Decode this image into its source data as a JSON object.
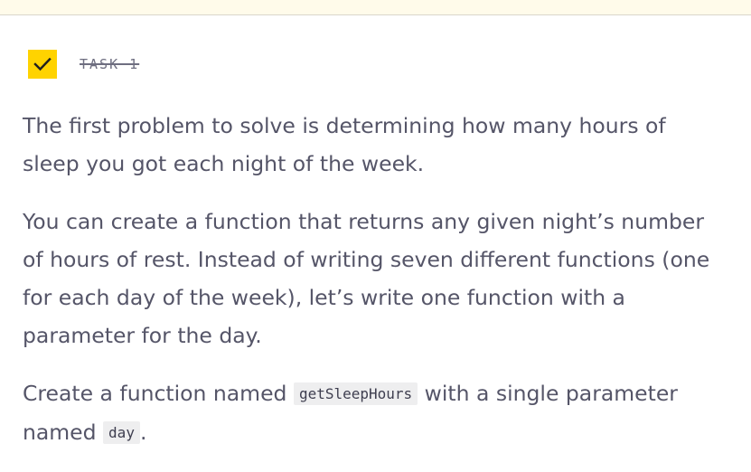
{
  "task": {
    "label": "TASK 1",
    "checked": true,
    "check_icon": "checkmark-icon",
    "accent_color": "#ffd300"
  },
  "content": {
    "paragraph_1": "The first problem to solve is determining how many hours of sleep you got each night of the week.",
    "paragraph_2": "You can create a function that returns any given night’s number of hours of rest. Instead of writing seven different functions (one for each day of the week), let’s write one function with a parameter for the day.",
    "paragraph_3": {
      "text_before": "Create a function named ",
      "code_1": "getSleepHours",
      "text_middle": " with a single parameter named ",
      "code_2": "day",
      "text_after": "."
    }
  }
}
